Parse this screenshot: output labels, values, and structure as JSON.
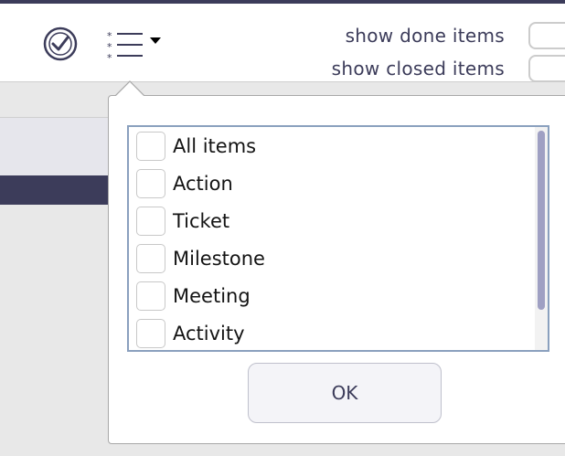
{
  "toolbar": {
    "done_icon": "check-circle-icon",
    "list_icon": "list-bullets-icon",
    "dropdown_icon": "caret-down-icon",
    "show_done_label": "show done items",
    "show_closed_label": "show closed items"
  },
  "popup": {
    "items": [
      {
        "label": "All items",
        "checked": false
      },
      {
        "label": "Action",
        "checked": false
      },
      {
        "label": "Ticket",
        "checked": false
      },
      {
        "label": "Milestone",
        "checked": false
      },
      {
        "label": "Meeting",
        "checked": false
      },
      {
        "label": "Activity",
        "checked": false
      }
    ],
    "ok_label": "OK"
  },
  "colors": {
    "accent": "#3c3c5a",
    "list_border": "#8aa0be",
    "scroll_thumb": "#9fa0c3"
  }
}
